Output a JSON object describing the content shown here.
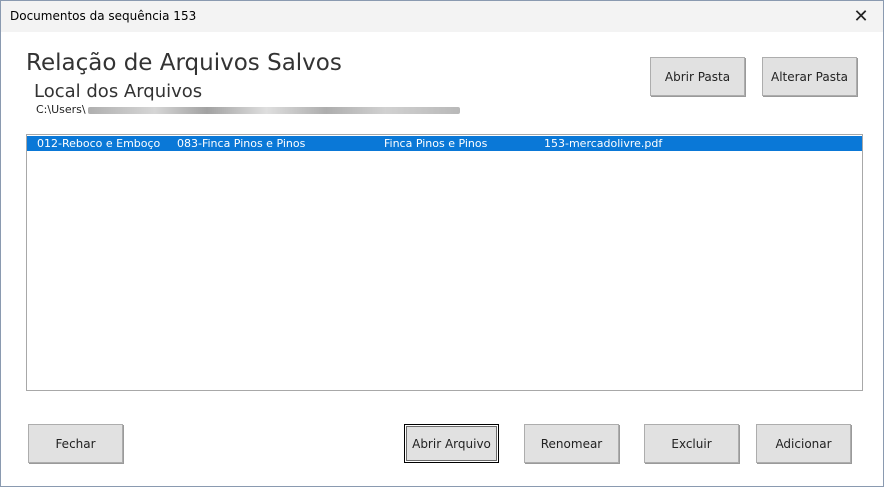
{
  "window": {
    "title": "Documentos da sequência 153",
    "close_glyph": "✕"
  },
  "header": {
    "title": "Relação de Arquivos Salvos",
    "subtitle": "Local dos Arquivos",
    "path_prefix": "C:\\Users\\"
  },
  "toolbar": {
    "open_folder_label": "Abrir Pasta",
    "change_folder_label": "Alterar Pasta"
  },
  "file_list": {
    "rows": [
      {
        "service": "012-Reboco e Emboço",
        "item": "083-Finca Pinos e Pinos",
        "description": "Finca Pinos e Pinos",
        "file": "153-mercadolivre.pdf",
        "selected": true
      }
    ]
  },
  "footer": {
    "close_label": "Fechar",
    "open_file_label": "Abrir Arquivo",
    "rename_label": "Renomear",
    "delete_label": "Excluir",
    "add_label": "Adicionar"
  },
  "colors": {
    "selection": "#0a78d7",
    "button_face": "#e1e1e1",
    "titlebar": "#f3f3f3"
  }
}
